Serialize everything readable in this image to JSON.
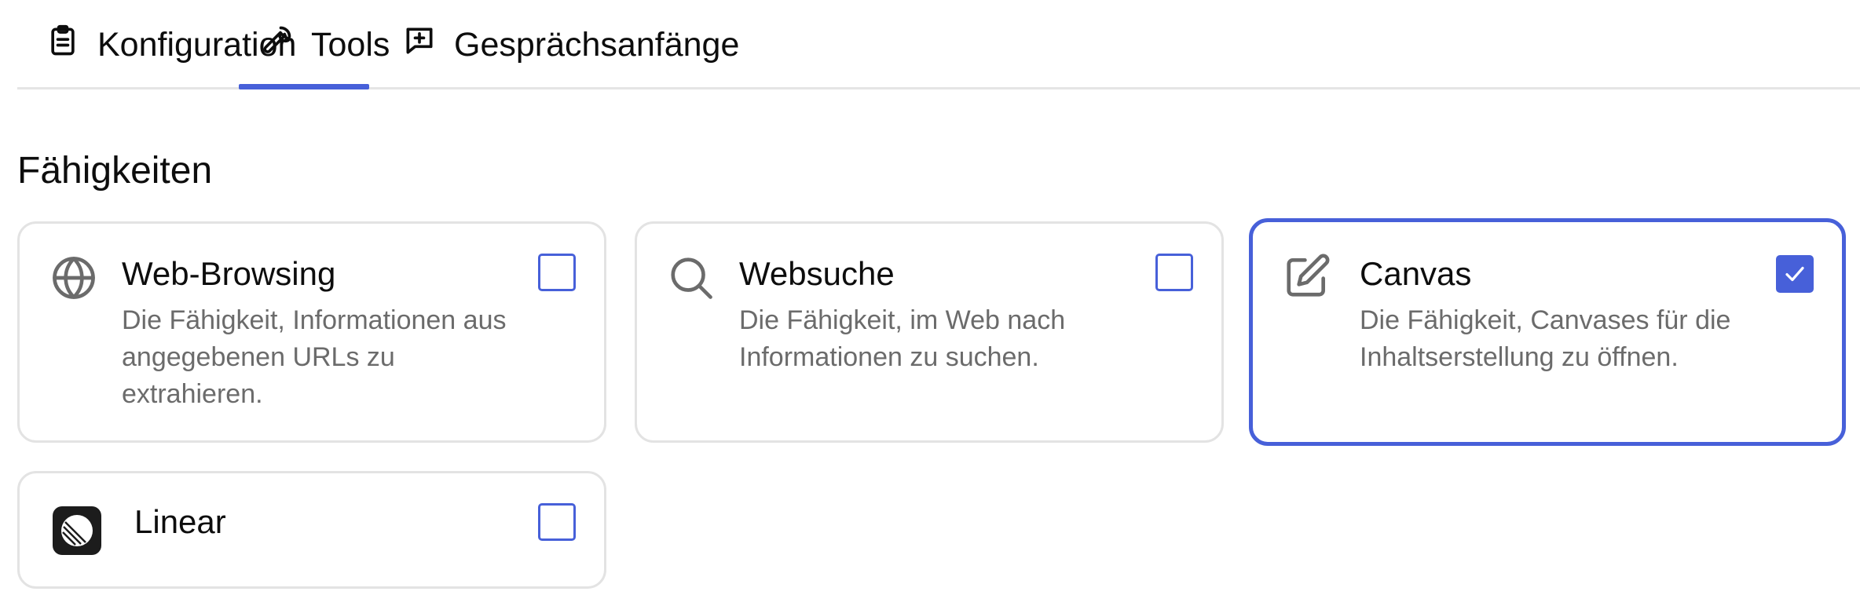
{
  "tabs": [
    {
      "label": "Konfiguration",
      "icon": "clipboard-icon",
      "active": false
    },
    {
      "label": "Tools",
      "icon": "wrench-icon",
      "active": true
    },
    {
      "label": "Gesprächsanfänge",
      "icon": "message-plus-icon",
      "active": false
    }
  ],
  "section": {
    "title": "Fähigkeiten"
  },
  "capabilities": [
    {
      "title": "Web-Browsing",
      "description": "Die Fähigkeit, Informationen aus angegebenen URLs zu extrahieren.",
      "icon": "globe-icon",
      "checked": false
    },
    {
      "title": "Websuche",
      "description": "Die Fähigkeit, im Web nach Informationen zu suchen.",
      "icon": "search-icon",
      "checked": false
    },
    {
      "title": "Canvas",
      "description": "Die Fähigkeit, Canvases für die Inhaltserstellung zu öffnen.",
      "icon": "edit-icon",
      "checked": true
    },
    {
      "title": "Linear",
      "description": "",
      "icon": "linear-logo-icon",
      "checked": false
    }
  ],
  "colors": {
    "accent": "#4760d9",
    "border": "#e3e3e3",
    "muted_text": "#6b6b6b"
  }
}
